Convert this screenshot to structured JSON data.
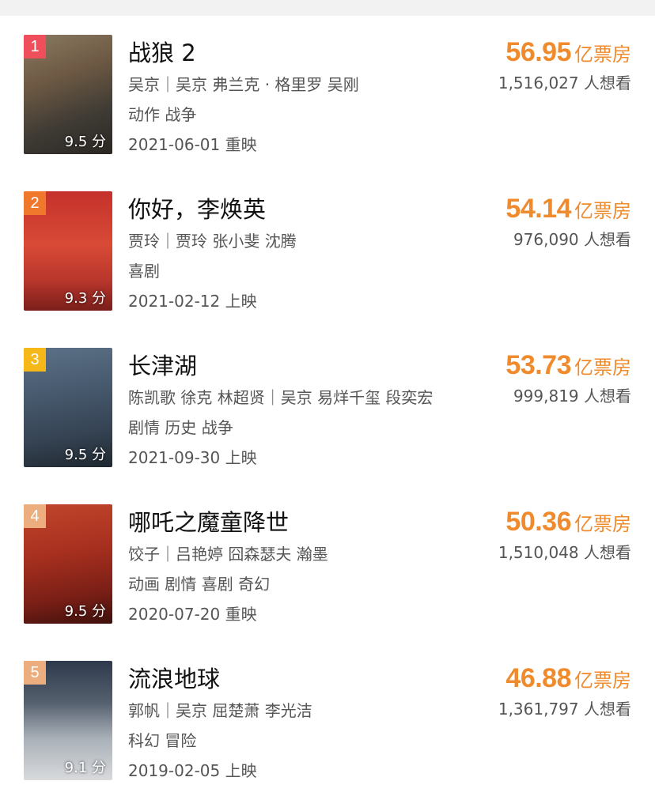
{
  "colors": {
    "accent": "#f08b2d",
    "rank_1": "#ee4f5b",
    "rank_2": "#f0782c",
    "rank_3": "#f6b719",
    "rank_4": "#ecae7e",
    "rank_5": "#ecae7e"
  },
  "movies": [
    {
      "rank": "1",
      "title": "战狼 2",
      "people": "吴京｜吴京 弗兰克 · 格里罗 吴刚",
      "genre": "动作 战争",
      "release": "2021-06-01 重映",
      "score": "9.5 分",
      "box_value": "56.95",
      "box_unit": "亿票房",
      "want": "1,516,027 人想看"
    },
    {
      "rank": "2",
      "title": "你好，李焕英",
      "people": "贾玲｜贾玲 张小斐 沈腾",
      "genre": "喜剧",
      "release": "2021-02-12 上映",
      "score": "9.3 分",
      "box_value": "54.14",
      "box_unit": "亿票房",
      "want": "976,090 人想看"
    },
    {
      "rank": "3",
      "title": "长津湖",
      "people": "陈凯歌 徐克 林超贤｜吴京 易烊千玺 段奕宏",
      "genre": "剧情 历史 战争",
      "release": "2021-09-30 上映",
      "score": "9.5 分",
      "box_value": "53.73",
      "box_unit": "亿票房",
      "want": "999,819 人想看"
    },
    {
      "rank": "4",
      "title": "哪吒之魔童降世",
      "people": "饺子｜吕艳婷 囧森瑟夫 瀚墨",
      "genre": "动画 剧情 喜剧 奇幻",
      "release": "2020-07-20 重映",
      "score": "9.5 分",
      "box_value": "50.36",
      "box_unit": "亿票房",
      "want": "1,510,048 人想看"
    },
    {
      "rank": "5",
      "title": "流浪地球",
      "people": "郭帆｜吴京 屈楚萧 李光洁",
      "genre": "科幻 冒险",
      "release": "2019-02-05 上映",
      "score": "9.1 分",
      "box_value": "46.88",
      "box_unit": "亿票房",
      "want": "1,361,797 人想看"
    }
  ]
}
